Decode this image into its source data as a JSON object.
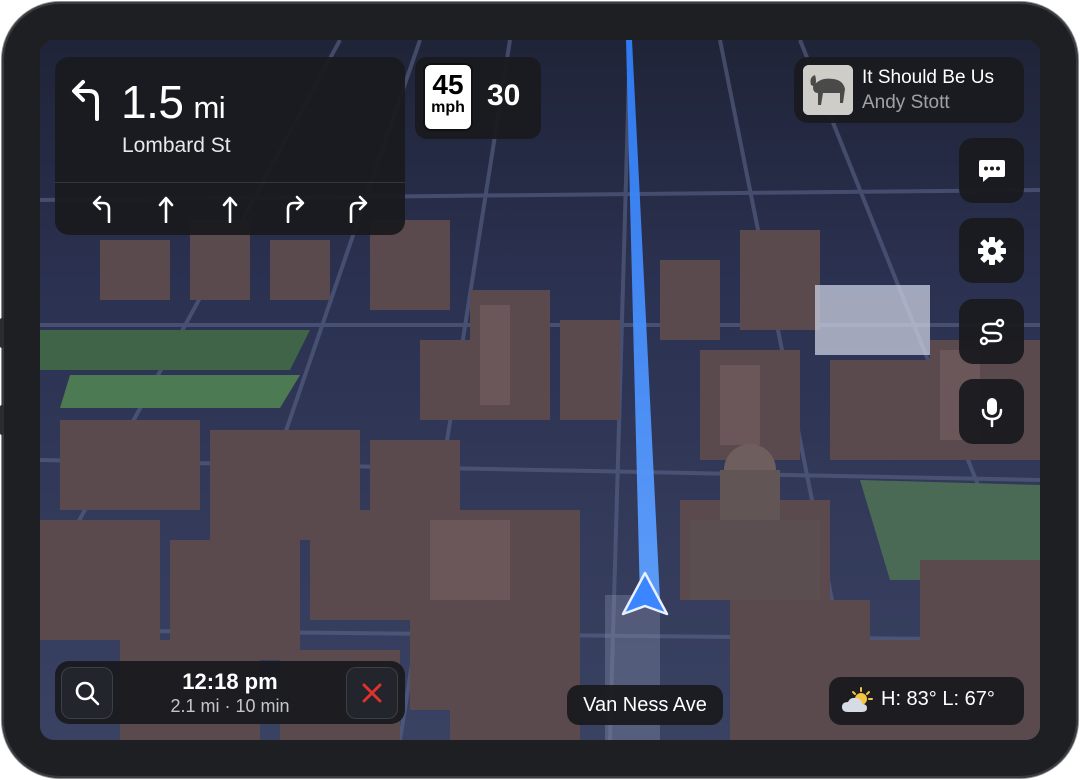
{
  "maneuver": {
    "turn_icon": "turn-left-arrow-icon",
    "distance": "1.5",
    "distance_unit": "mi",
    "street": "Lombard St",
    "lanes": [
      {
        "icon": "lane-turn-left-icon",
        "active": true
      },
      {
        "icon": "lane-straight-icon",
        "active": true
      },
      {
        "icon": "lane-straight-icon",
        "active": true
      },
      {
        "icon": "lane-turn-right-icon",
        "active": true
      },
      {
        "icon": "lane-turn-right-icon",
        "active": true
      }
    ]
  },
  "speed": {
    "limit": "45",
    "limit_unit": "mph",
    "current": "30"
  },
  "now_playing": {
    "title": "It Should Be Us",
    "artist": "Andy Stott",
    "artwork_icon": "album-art"
  },
  "side_buttons": [
    {
      "icon": "message-icon"
    },
    {
      "icon": "gear-icon"
    },
    {
      "icon": "route-icon"
    },
    {
      "icon": "microphone-icon"
    }
  ],
  "trip": {
    "search_icon": "search-icon",
    "arrival_time": "12:18 pm",
    "summary": "2.1 mi · 10 min",
    "close_icon": "close-icon"
  },
  "current_street": "Van Ness Ave",
  "weather": {
    "icon": "partly-cloudy-icon",
    "temps": "H: 83°  L: 67°"
  },
  "colors": {
    "route": "#2f7cf6",
    "panel": "#1a1b1f",
    "close_red": "#e0312b",
    "map_building": "#5a4a4e",
    "map_street": "#3b4466"
  }
}
